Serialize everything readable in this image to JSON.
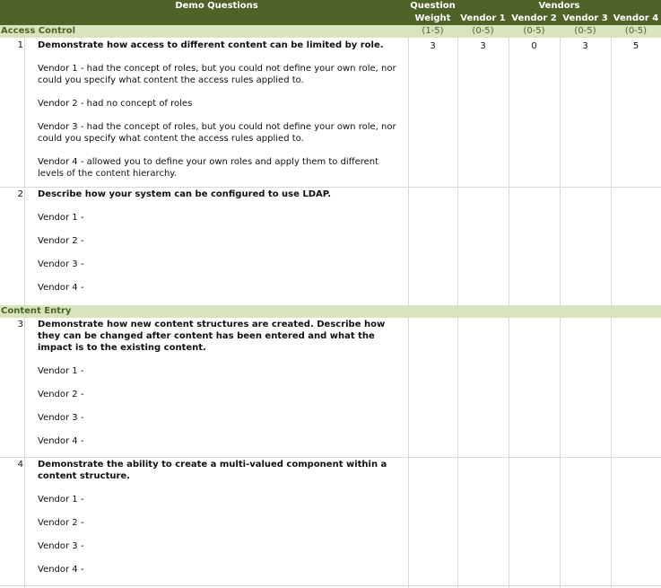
{
  "header": {
    "demo_questions": "Demo Questions",
    "question": "Question",
    "weight": "Weight",
    "vendors": "Vendors",
    "vendor1": "Vendor 1",
    "vendor2": "Vendor 2",
    "vendor3": "Vendor 3",
    "vendor4": "Vendor 4"
  },
  "ranges": {
    "weight": "(1-5)",
    "v1": "(0-5)",
    "v2": "(0-5)",
    "v3": "(0-5)",
    "v4": "(0-5)"
  },
  "sections": {
    "access_control": "Access Control",
    "content_entry": "Content Entry"
  },
  "q1": {
    "num": "1",
    "text": "Demonstrate how access to different content can be limited by role.",
    "weight": "3",
    "v1": "3",
    "v2": "0",
    "v3": "3",
    "v4": "5",
    "vendor1": "Vendor 1 - had the concept of roles, but you could not define your own role, nor could you specify what content the access rules applied to.",
    "vendor2": "Vendor 2 - had no concept of roles",
    "vendor3": "Vendor 3 - had the concept of roles, but you could not define your own role, nor could you specify what content the access rules applied to.",
    "vendor4": "Vendor 4 - allowed you to define your own roles and apply them to different levels of the content hierarchy."
  },
  "q2": {
    "num": "2",
    "text": "Describe how your system can be configured to use LDAP.",
    "vendor1": "Vendor 1 -",
    "vendor2": "Vendor 2 -",
    "vendor3": "Vendor 3 -",
    "vendor4": "Vendor 4 -"
  },
  "q3": {
    "num": "3",
    "text": "Demonstrate how new content structures are created.  Describe how they can be changed after content has been entered and what the impact is to the existing content.",
    "vendor1": "Vendor 1 -",
    "vendor2": "Vendor 2 -",
    "vendor3": "Vendor 3 -",
    "vendor4": "Vendor 4 -"
  },
  "q4": {
    "num": "4",
    "text": "Demonstrate the ability to create a multi-valued component within a content structure.",
    "vendor1": "Vendor 1 -",
    "vendor2": "Vendor 2 -",
    "vendor3": "Vendor 3 -",
    "vendor4": "Vendor 4 -"
  }
}
